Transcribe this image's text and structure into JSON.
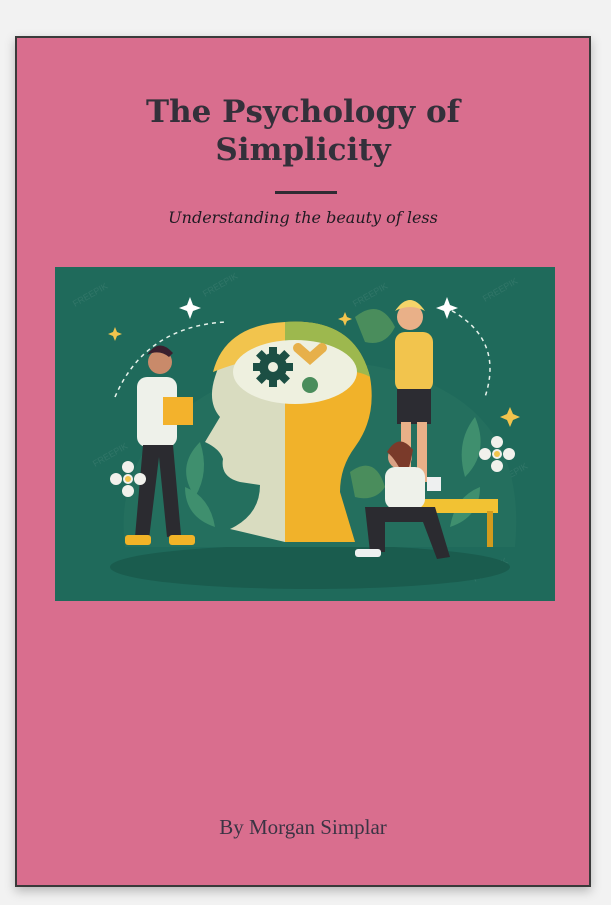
{
  "book": {
    "title": "The Psychology of Simplicity",
    "subtitle": "Understanding the beauty of less",
    "author": "By Morgan Simplar"
  },
  "illustration": {
    "icon": "head-puzzle-illustration",
    "watermark": "FREEPIK"
  },
  "colors": {
    "cover": "#d96e8e",
    "border": "#3a3a3a",
    "illustration_bg": "#1f6a5b",
    "text": "#33303a"
  }
}
